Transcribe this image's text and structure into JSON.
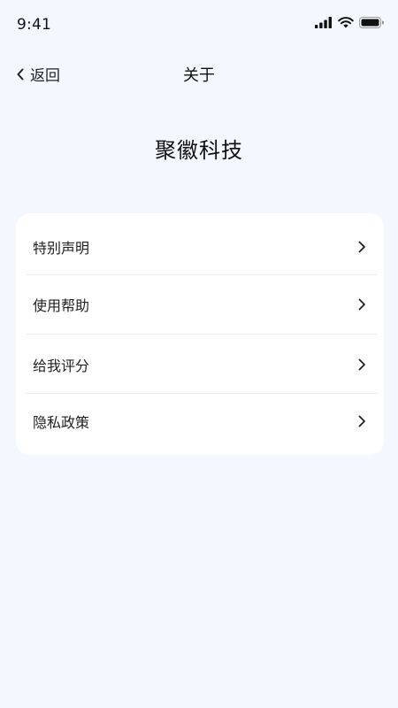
{
  "status_bar": {
    "time": "9:41",
    "icons": [
      "cellular-signal-icon",
      "wifi-icon",
      "battery-icon"
    ]
  },
  "nav": {
    "back_label": "返回",
    "title": "关于"
  },
  "company": {
    "name": "聚徽科技"
  },
  "menu": {
    "items": [
      {
        "label": "特别声明"
      },
      {
        "label": "使用帮助"
      },
      {
        "label": "给我评分"
      },
      {
        "label": "隐私政策"
      }
    ]
  },
  "colors": {
    "background": "#f4f7fe",
    "card": "#ffffff",
    "divider": "#ececec",
    "text": "#1a1a1a"
  }
}
